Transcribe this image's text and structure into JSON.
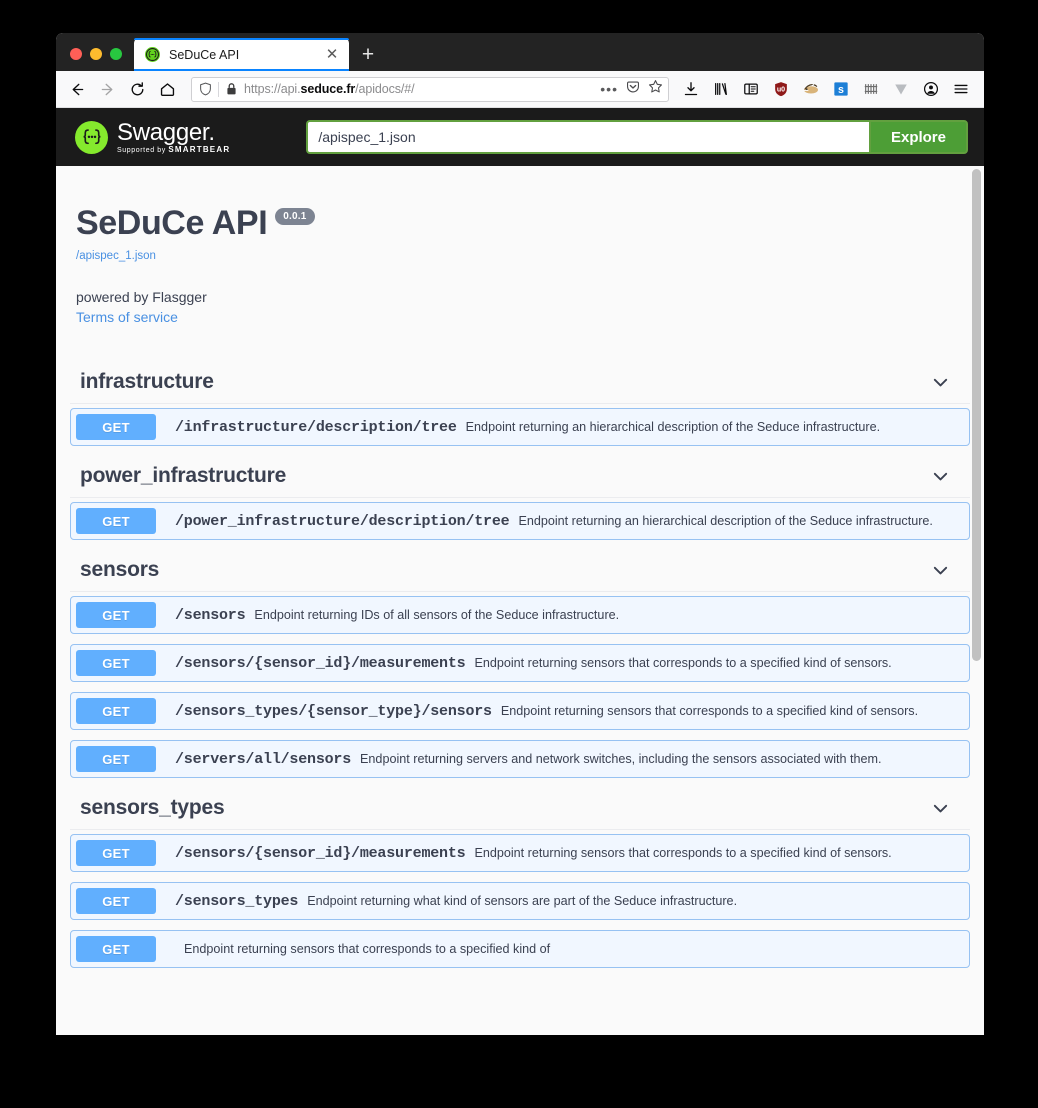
{
  "browser": {
    "tab": {
      "title": "SeDuCe API",
      "favicon": "swagger-favicon",
      "close_label": "✕"
    },
    "new_tab_label": "+",
    "url": {
      "prefix": "https://api.",
      "host": "seduce.fr",
      "suffix": "/apidocs/#/",
      "full": "https://api.seduce.fr/apidocs/#/"
    },
    "nav": {
      "back": "←",
      "forward": "→",
      "reload": "↻",
      "home": "⌂"
    },
    "url_actions": {
      "more": "•••",
      "pocket": "pocket-icon",
      "bookmark": "star-icon"
    },
    "toolbar_icons": [
      "downloads-icon",
      "library-icon",
      "sidebar-icon",
      "ublock-origin-icon",
      "badger-icon",
      "s-extension-icon",
      "grid-extension-icon",
      "v-extension-icon",
      "account-icon",
      "menu-icon"
    ]
  },
  "swagger": {
    "brand": {
      "name": "Swagger",
      "trademark": ".",
      "supported_by_prefix": "Supported by",
      "supported_by_brand": "SMARTBEAR"
    },
    "spec_input_value": "/apispec_1.json",
    "spec_input_placeholder": "/apispec_1.json",
    "explore_label": "Explore"
  },
  "info": {
    "title": "SeDuCe API",
    "version": "0.0.1",
    "spec_link": "/apispec_1.json",
    "powered_by": "powered by Flasgger",
    "terms_of_service": "Terms of service"
  },
  "tags": [
    {
      "name": "infrastructure",
      "operations": [
        {
          "method": "GET",
          "path": "/infrastructure/description/tree",
          "description": "Endpoint returning an hierarchical description of the Seduce infrastructure."
        }
      ]
    },
    {
      "name": "power_infrastructure",
      "operations": [
        {
          "method": "GET",
          "path": "/power_infrastructure/description/tree",
          "description": "Endpoint returning an hierarchical description of the Seduce infrastructure."
        }
      ]
    },
    {
      "name": "sensors",
      "operations": [
        {
          "method": "GET",
          "path": "/sensors",
          "description": "Endpoint returning IDs of all sensors of the Seduce infrastructure."
        },
        {
          "method": "GET",
          "path": "/sensors/{sensor_id}/measurements",
          "description": "Endpoint returning sensors that corresponds to a specified kind of sensors."
        },
        {
          "method": "GET",
          "path": "/sensors_types/{sensor_type}/sensors",
          "description": "Endpoint returning sensors that corresponds to a specified kind of sensors."
        },
        {
          "method": "GET",
          "path": "/servers/all/sensors",
          "description": "Endpoint returning servers and network switches, including the sensors associated with them."
        }
      ]
    },
    {
      "name": "sensors_types",
      "operations": [
        {
          "method": "GET",
          "path": "/sensors/{sensor_id}/measurements",
          "description": "Endpoint returning sensors that corresponds to a specified kind of sensors."
        },
        {
          "method": "GET",
          "path": "/sensors_types",
          "description": "Endpoint returning what kind of sensors are part of the Seduce infrastructure."
        },
        {
          "method": "GET",
          "path": "",
          "description": "Endpoint returning sensors that corresponds to a specified kind of"
        }
      ]
    }
  ],
  "colors": {
    "swagger_green": "#85ea2d",
    "explore_green": "#4d9e36",
    "get_blue": "#61affe",
    "op_row_bg": "#f1f7ff",
    "op_row_border": "#97c2f2",
    "text_dark": "#3b4151",
    "link_blue": "#4990e2",
    "badge_gray": "#7d8492",
    "topbar_black": "#1b1b1b"
  }
}
